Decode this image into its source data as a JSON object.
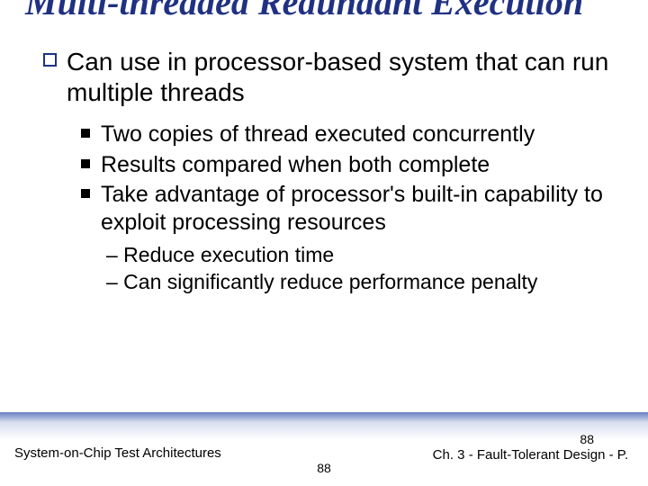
{
  "title": "Multi-threaded Redundant Execution",
  "l1": "Can use in processor-based system that can run multiple threads",
  "l2": {
    "a": "Two copies of thread executed concurrently",
    "b": "Results compared when both complete",
    "c": "Take advantage of processor's built-in capability to exploit processing resources"
  },
  "l3": {
    "a": "– Reduce execution time",
    "b": "– Can significantly reduce performance penalty"
  },
  "footer": {
    "left": "System-on-Chip Test Architectures",
    "right": "Ch. 3 - Fault-Tolerant Design - P.",
    "page": "88",
    "trunc": "88"
  }
}
